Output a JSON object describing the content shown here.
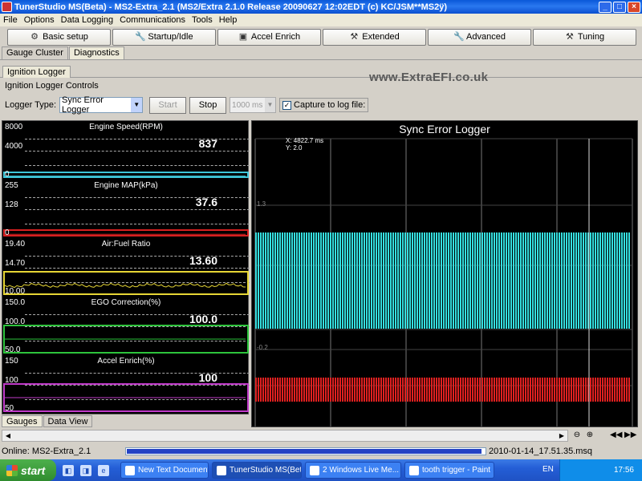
{
  "window": {
    "title": "TunerStudio MS(Beta) - MS2-Extra_2.1 (MS2/Extra 2.1.0 Release  20090627 12:02EDT (c) KC/JSM**MS2ÿ)",
    "minimize": "_",
    "maximize": "□",
    "close": "×"
  },
  "menu": {
    "items": [
      "File",
      "Options",
      "Data Logging",
      "Communications",
      "Tools",
      "Help"
    ]
  },
  "toolbar": {
    "buttons": [
      {
        "label": "Basic setup",
        "icon": "basic-setup-icon"
      },
      {
        "label": "Startup/Idle",
        "icon": "wrench-icon"
      },
      {
        "label": "Accel Enrich",
        "icon": "engine-icon"
      },
      {
        "label": "Extended",
        "icon": "hammer-icon"
      },
      {
        "label": "Advanced",
        "icon": "wrench-icon"
      },
      {
        "label": "Tuning",
        "icon": "tools-icon"
      }
    ]
  },
  "tabs": {
    "items": [
      "Gauge Cluster",
      "Diagnostics"
    ],
    "active": "Diagnostics"
  },
  "subtab": {
    "label": "Ignition Logger"
  },
  "controls": {
    "title": "Ignition Logger Controls",
    "logger_type_label": "Logger Type:",
    "logger_type_value": "Sync Error Logger",
    "start_label": "Start",
    "stop_label": "Stop",
    "interval_value": "1000 ms",
    "capture_label": "Capture to log file:",
    "capture_checked": "✓"
  },
  "watermark": "www.ExtraEFI.co.uk",
  "gauges": [
    {
      "title": "Engine Speed(RPM)",
      "max": "8000",
      "mid": "4000",
      "min": "0",
      "value": "837",
      "color": "#3fc6d8",
      "level": 0.105
    },
    {
      "title": "Engine MAP(kPa)",
      "max": "255",
      "mid": "128",
      "min": "0",
      "value": "37.6",
      "color": "#d62020",
      "level": 0.147
    },
    {
      "title": "Air:Fuel Ratio",
      "max": "19.40",
      "mid": "14.70",
      "min": "10.00",
      "value": "13.60",
      "color": "#e6d635",
      "level": 0.383
    },
    {
      "title": "EGO Correction(%)",
      "max": "150.0",
      "mid": "100.0",
      "min": "50.0",
      "value": "100.0",
      "color": "#2dc43c",
      "level": 0.5
    },
    {
      "title": "Accel Enrich(%)",
      "max": "150",
      "mid": "100",
      "min": "50",
      "value": "100",
      "color": "#c03ac9",
      "level": 0.5
    }
  ],
  "gauge_tabs": [
    "Gauges",
    "Data View"
  ],
  "logger_chart": {
    "title": "Sync Error Logger",
    "readout_x": "X: 4822.7 ms",
    "readout_y": "Y: 2.0",
    "ytick_high": "1.3",
    "ytick_low": "-0.2",
    "trace_colors": [
      "#34e0e0",
      "#e02020"
    ]
  },
  "status": {
    "online": "Online: MS2-Extra_2.1",
    "progress": 0.99,
    "file": "2010-01-14_17.51.35.msq"
  },
  "taskbar": {
    "start": "start",
    "tasks": [
      {
        "label": "New Text Document ...",
        "active": false
      },
      {
        "label": "TunerStudio MS(Beta...",
        "active": true
      },
      {
        "label": "2 Windows Live Me...",
        "active": false
      },
      {
        "label": "tooth trigger - Paint",
        "active": false
      }
    ],
    "lang": "EN",
    "clock": "17:56"
  }
}
